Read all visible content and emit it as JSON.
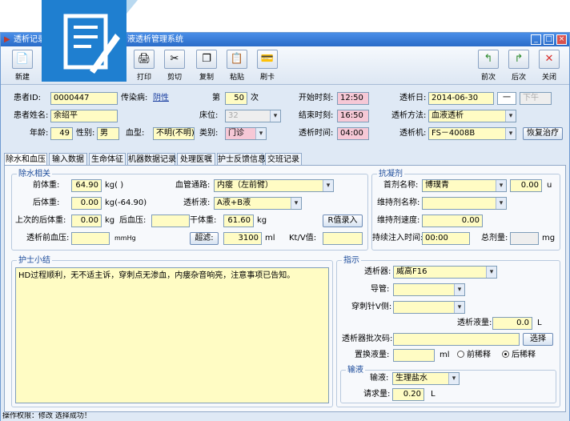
{
  "window": {
    "title": "透析记录 - 血液透析管理系统",
    "title_left": "透析记录",
    "title_right": "液透析管理系统"
  },
  "toolbar": {
    "new": "新建",
    "print": "打印",
    "cut": "剪切",
    "copy": "复制",
    "paste": "粘贴",
    "swipe": "刷卡",
    "prev": "前次",
    "next": "后次",
    "close": "关闭"
  },
  "patient": {
    "id_label": "患者ID:",
    "id": "0000447",
    "infect_label": "传染病:",
    "infect": "阴性",
    "times_label": "第",
    "times": "50",
    "times_unit": "次",
    "start_label": "开始时刻:",
    "start": "12:50",
    "date_label": "透析日:",
    "date": "2014-06-30",
    "dash": "一",
    "ampm": "下午",
    "name_label": "患者姓名:",
    "name": "余绍平",
    "bed_label": "床位:",
    "bed": "32",
    "end_label": "结束时刻:",
    "end": "16:50",
    "method_label": "透析方法:",
    "method": "血液透析",
    "age_label": "年龄:",
    "age": "49",
    "sex_label": "性别:",
    "sex": "男",
    "blood_label": "血型:",
    "blood": "不明(不明)",
    "type_label": "类别:",
    "type": "门诊",
    "duration_label": "透析时间:",
    "duration": "04:00",
    "machine_label": "透析机:",
    "machine": "FS－4008B",
    "restore": "恢复治疗"
  },
  "tabs": [
    "除水和血压",
    "输入数据",
    "生命体征",
    "机器数据记录",
    "处理医嘱",
    "护士反馈信息",
    "交班记录"
  ],
  "dewater": {
    "title": "除水相关",
    "pre_label": "前体重:",
    "pre": "64.90",
    "pre_unit": "kg(     )",
    "post_label": "后体重:",
    "post": "0.00",
    "post_unit": "kg(-64.90)",
    "last_label": "上次的后体重:",
    "last": "0.00",
    "last_unit": "kg",
    "pre_bp_label": "透析前血压:",
    "pre_bp_unit": "mmHg",
    "access_label": "血管通路:",
    "access": "内瘘（左前臂）",
    "fluid_label": "透析液:",
    "fluid": "A液+B液",
    "post_bp_label": "后血压:",
    "dry_label": "干体重:",
    "dry": "61.60",
    "dry_unit": "kg",
    "r_btn": "R值录入",
    "uf_btn": "超滤:",
    "uf": "3100",
    "uf_unit": "ml",
    "ktv_label": "Kt/V值:"
  },
  "anticoag": {
    "title": "抗凝剂",
    "first_label": "首剂名称:",
    "first": "博璞青",
    "first_dose": "0.00",
    "first_unit": "u",
    "maint_label": "维持剂名称:",
    "speed_label": "维持剂速度:",
    "speed": "0.00",
    "cont_label": "持续注入时间:",
    "cont": "00:00",
    "total_label": "总剂量:",
    "total_unit": "mg"
  },
  "nurse": {
    "title": "护士小结",
    "text": "HD过程顺利，无不适主诉，穿刺点无渗血，内瘘杂音响亮，注意事项已告知。"
  },
  "instruction": {
    "title": "指示",
    "dialyzer_label": "透析器:",
    "dialyzer": "威高F16",
    "tube_label": "导管:",
    "needle_label": "穿刺针V侧:",
    "volume_label": "透析液量:",
    "volume": "0.0",
    "volume_unit": "L",
    "batch_label": "透析器批次码:",
    "select_btn": "选择",
    "replace_label": "置换液量:",
    "replace_unit": "ml",
    "pre_dilute": "前稀释",
    "post_dilute": "后稀释",
    "infusion_title": "输液",
    "infusion_label": "输液:",
    "infusion": "生理盐水",
    "request_label": "请求量:",
    "request": "0.20",
    "request_unit": "L"
  },
  "status": "操作权限：修改     选择成功！"
}
